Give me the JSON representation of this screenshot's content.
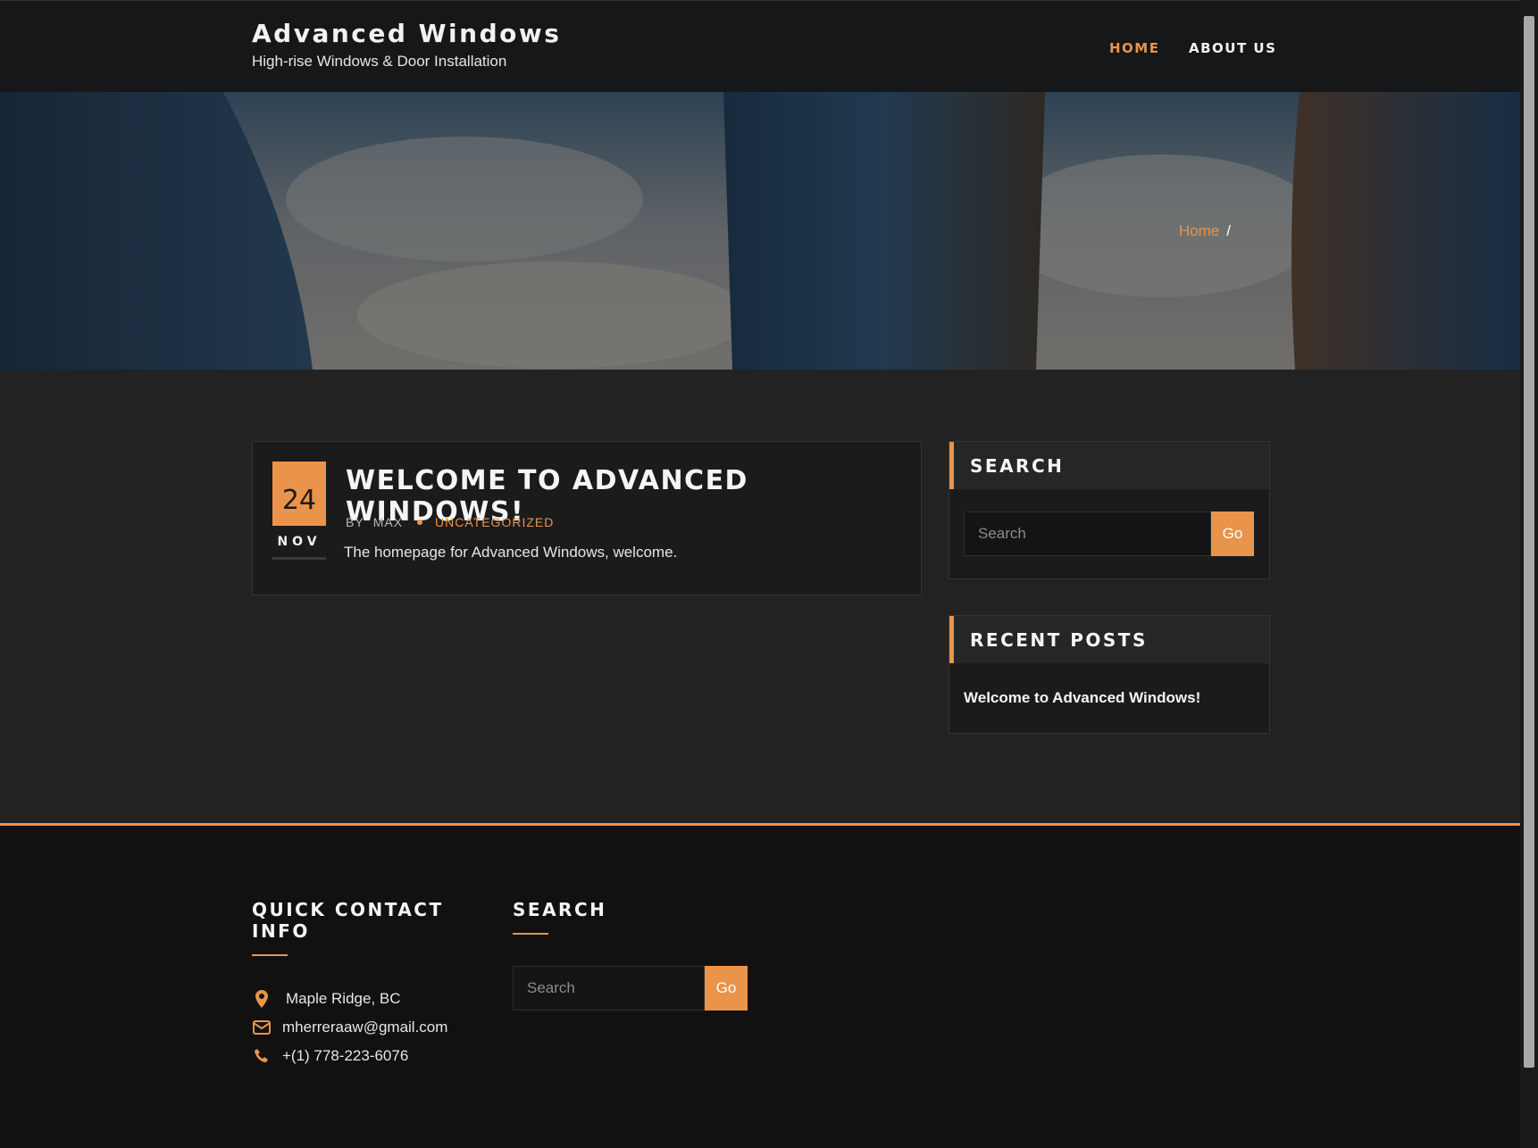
{
  "site": {
    "title": "Advanced Windows",
    "tagline": "High-rise Windows & Door Installation"
  },
  "nav": {
    "items": [
      {
        "label": "HOME",
        "active": true
      },
      {
        "label": "ABOUT US",
        "active": false
      }
    ]
  },
  "breadcrumb": {
    "home": "Home",
    "separator": "/"
  },
  "post": {
    "day": "24",
    "month": "NOV",
    "title": "WELCOME TO ADVANCED WINDOWS!",
    "by": "BY",
    "author": "MAX",
    "category": "UNCATEGORIZED",
    "excerpt": "The homepage for Advanced Windows, welcome."
  },
  "sidebar": {
    "search": {
      "title": "SEARCH",
      "placeholder": "Search",
      "button": "Go"
    },
    "recent": {
      "title": "RECENT POSTS",
      "items": [
        "Welcome to Advanced Windows!"
      ]
    }
  },
  "footer": {
    "contact": {
      "title_line1": "QUICK CONTACT",
      "title_line2": "INFO",
      "address": "Maple Ridge, BC",
      "email": "mherreraaw@gmail.com",
      "phone": "+(1) 778-223-6076"
    },
    "search": {
      "title": "SEARCH",
      "placeholder": "Search",
      "button": "Go"
    }
  },
  "colors": {
    "accent": "#e9944a",
    "header_bg": "#161718",
    "body_bg": "#222223",
    "footer_bg": "#111112"
  }
}
